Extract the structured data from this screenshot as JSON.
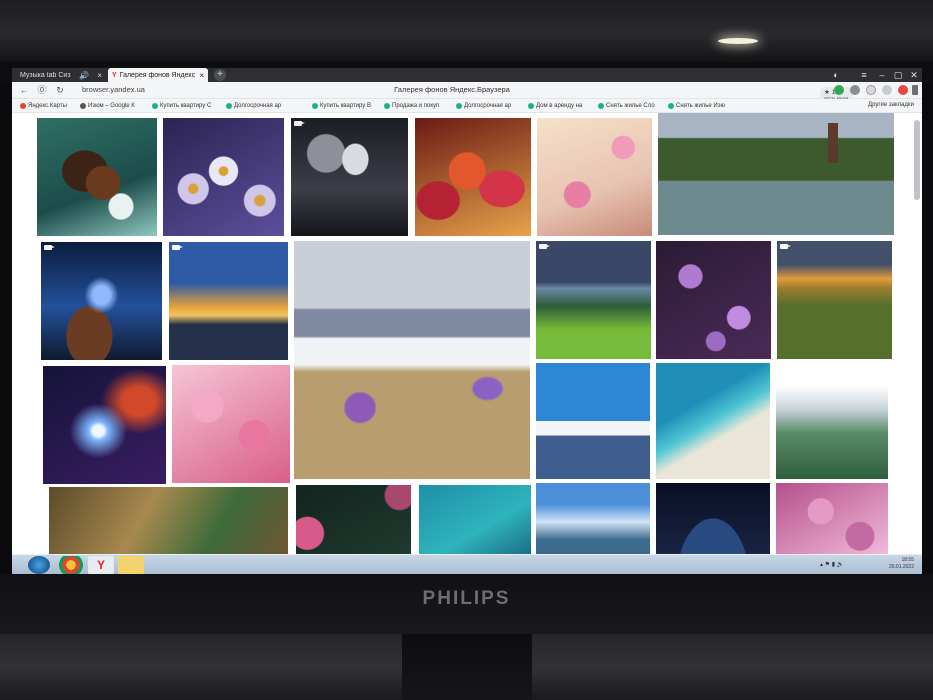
{
  "tabs": [
    {
      "label": "Музыка tab Сиз",
      "state": "inactive"
    },
    {
      "label": "Галерея фонов Яндекс",
      "state": "active",
      "favicon": "Y"
    }
  ],
  "address_bar": {
    "url": "browser.yandex.ua",
    "page_title": "Галерея фонов Яндекс.Браузера",
    "reviews": "★ 175 отзывов"
  },
  "bookmarks": [
    {
      "label": "Яндекс.Карты",
      "icon": "map-pin-icon",
      "color": "#e8412c"
    },
    {
      "label": "Изюм – Google К",
      "icon": "map-pin-icon",
      "color": "#555555"
    },
    {
      "label": "Купить квартиру С",
      "icon": "site-icon",
      "color": "#19b38d"
    },
    {
      "label": "Долгосрочная ар",
      "icon": "site-icon",
      "color": "#19b38d"
    },
    {
      "label": "Купить квартиру В",
      "icon": "site-icon",
      "color": "#19b38d"
    },
    {
      "label": "Продажа и покуп",
      "icon": "site-icon",
      "color": "#19b38d"
    },
    {
      "label": "Долгосрочная ар",
      "icon": "site-icon",
      "color": "#19b38d"
    },
    {
      "label": "Дом в аренду на",
      "icon": "site-icon",
      "color": "#19b38d"
    },
    {
      "label": "Снять жилье Сло",
      "icon": "site-icon",
      "color": "#19b38d"
    },
    {
      "label": "Снять жилье Изю",
      "icon": "site-icon",
      "color": "#19b38d"
    }
  ],
  "other_bookmarks": "Другие закладки",
  "taskbar": {
    "time": "18:55",
    "date": "20.01.2022"
  },
  "monitor_brand": "PHILIPS",
  "gallery": [
    {
      "name": "wallpaper-coast-aerial",
      "video": false
    },
    {
      "name": "wallpaper-daisies",
      "video": false
    },
    {
      "name": "wallpaper-storm-clouds",
      "video": true
    },
    {
      "name": "wallpaper-tulips",
      "video": false
    },
    {
      "name": "wallpaper-pink-blossoms",
      "video": false
    },
    {
      "name": "wallpaper-lake-castle",
      "video": false
    },
    {
      "name": "wallpaper-ocean-waves",
      "video": true
    },
    {
      "name": "wallpaper-sunset-clouds",
      "video": true
    },
    {
      "name": "wallpaper-crocus-mountains",
      "video": false
    },
    {
      "name": "wallpaper-green-valley",
      "video": true
    },
    {
      "name": "wallpaper-lilac",
      "video": false
    },
    {
      "name": "wallpaper-field-sunset",
      "video": true
    },
    {
      "name": "wallpaper-nebula",
      "video": false
    },
    {
      "name": "wallpaper-sakura-branch",
      "video": false
    },
    {
      "name": "wallpaper-fuji",
      "video": false
    },
    {
      "name": "wallpaper-turquoise-beach",
      "video": false
    },
    {
      "name": "wallpaper-misty-forest",
      "video": false
    },
    {
      "name": "wallpaper-autumn-aerial",
      "video": false
    },
    {
      "name": "wallpaper-dark-flowers",
      "video": false
    },
    {
      "name": "wallpaper-boats-lagoon",
      "video": false
    },
    {
      "name": "wallpaper-blue-sky",
      "video": false
    },
    {
      "name": "wallpaper-earth-night",
      "video": false
    },
    {
      "name": "wallpaper-pink-flowers",
      "video": false
    }
  ]
}
